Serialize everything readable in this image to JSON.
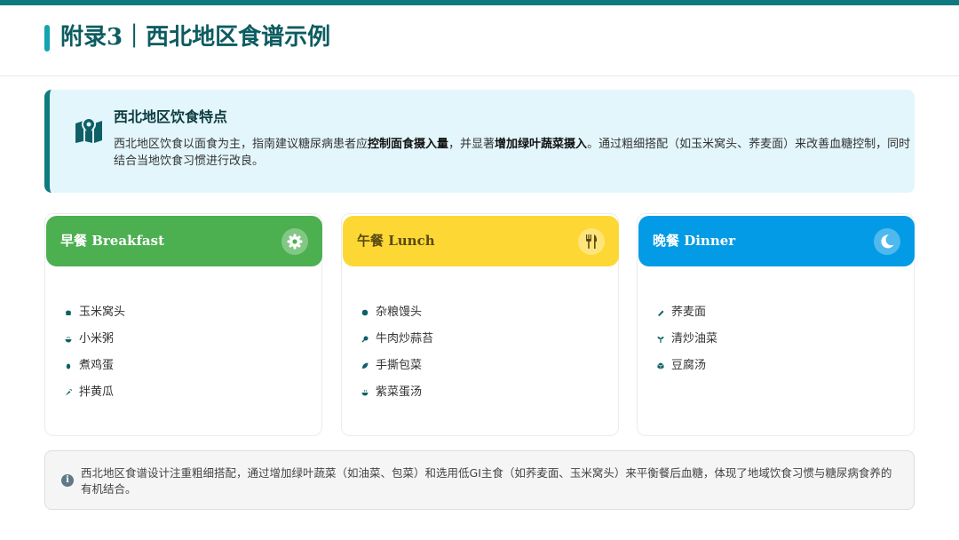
{
  "header": {
    "title": "附录3｜西北地区食谱示例"
  },
  "intro": {
    "title": "西北地区饮食特点",
    "icon": "map-icon",
    "text_before": "西北地区饮食以面食为主，指南建议糖尿病患者应",
    "bold_1": "控制面食摄入量",
    "text_middle": "，并显著",
    "bold_2": "增加绿叶蔬菜摄入",
    "text_after": "。通过粗细搭配（如玉米窝头、荞麦面）来改善血糖控制，同时结合当地饮食习惯进行改良。"
  },
  "meals": {
    "breakfast": {
      "title": "早餐 Breakfast",
      "icon": "gear-icon",
      "items": [
        "玉米窝头",
        "小米粥",
        "煮鸡蛋",
        "拌黄瓜"
      ]
    },
    "lunch": {
      "title": "午餐 Lunch",
      "icon": "utensils-icon",
      "items": [
        "杂粮馒头",
        "牛肉炒蒜苔",
        "手撕包菜",
        "紫菜蛋汤"
      ]
    },
    "dinner": {
      "title": "晚餐 Dinner",
      "icon": "moon-icon",
      "items": [
        "荞麦面",
        "清炒油菜",
        "豆腐汤"
      ]
    }
  },
  "note": {
    "icon": "info-icon",
    "text": "西北地区食谱设计注重粗细搭配，通过增加绿叶蔬菜（如油菜、包菜）和选用低GI主食（如荞麦面、玉米窝头）来平衡餐后血糖，体现了地域饮食习惯与糖尿病食养的有机结合。"
  },
  "colors": {
    "accent": "#0e7a80",
    "breakfast": "#4caf50",
    "lunch": "#fdd835",
    "dinner": "#039be5",
    "intro_bg": "#e3f6fb"
  }
}
